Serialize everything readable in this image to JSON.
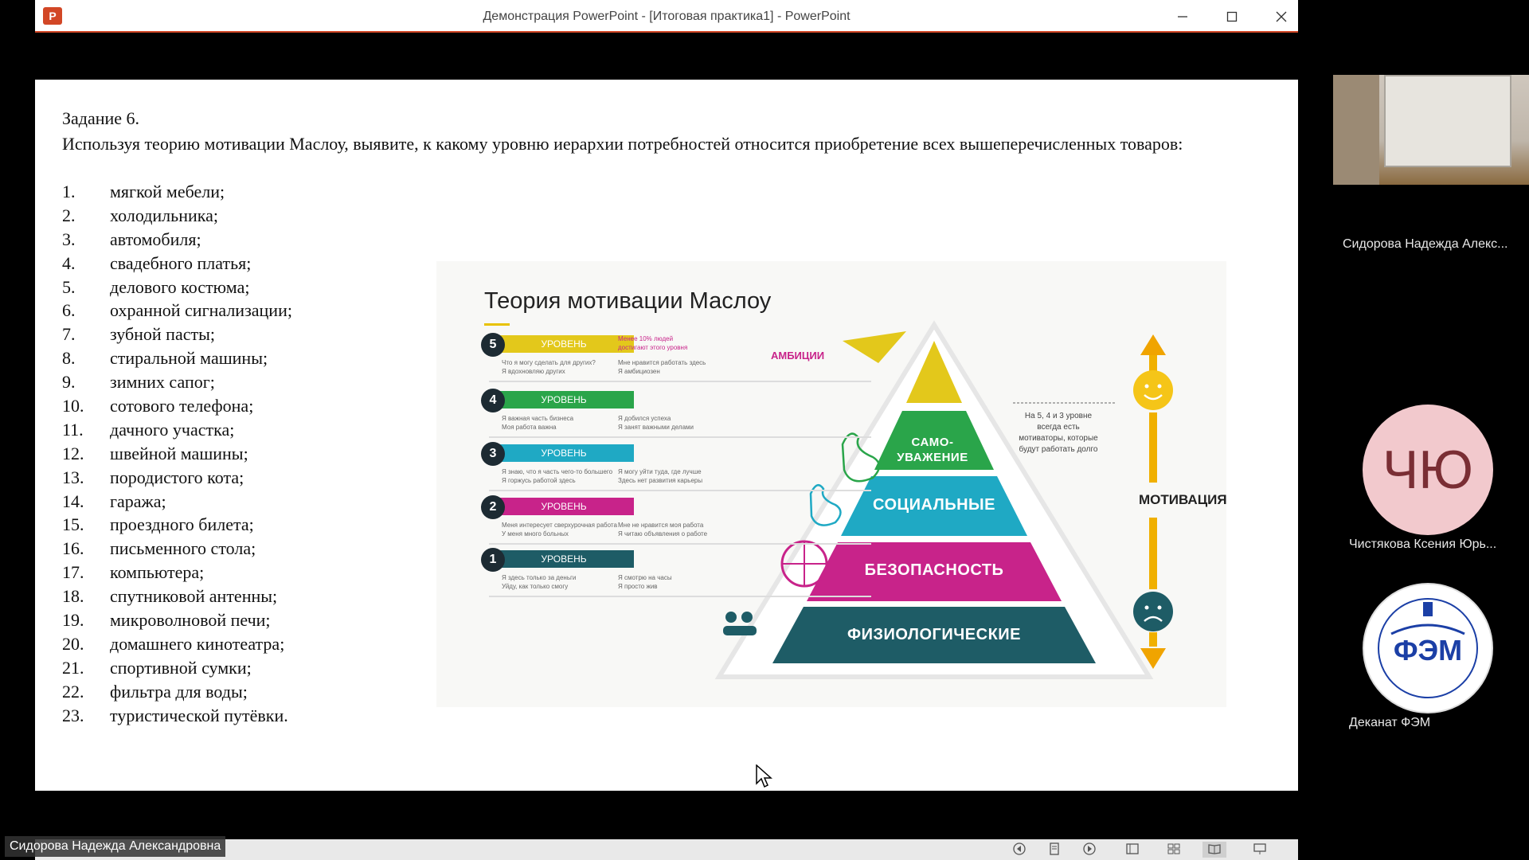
{
  "window": {
    "title": "Демонстрация PowerPoint - [Итоговая практика1] - PowerPoint",
    "app_icon": "P",
    "controls": {
      "minimize": "—",
      "maximize": "☐",
      "close": "✕"
    }
  },
  "slide": {
    "task_title": "Задание 6.",
    "task_text": "Используя теорию мотивации Маслоу, выявите, к какому уровню иерархии потребностей относится приобретение всех вышеперечисленных товаров:",
    "items": [
      {
        "num": "1.",
        "text": "мягкой мебели;"
      },
      {
        "num": "2.",
        "text": "холодильника;"
      },
      {
        "num": "3.",
        "text": "автомобиля;"
      },
      {
        "num": "4.",
        "text": "свадебного платья;"
      },
      {
        "num": "5.",
        "text": "делового костюма;"
      },
      {
        "num": "6.",
        "text": "охранной сигнализации;"
      },
      {
        "num": "7.",
        "text": "зубной пасты;"
      },
      {
        "num": "8.",
        "text": "стиральной машины;"
      },
      {
        "num": "9.",
        "text": "зимних сапог;"
      },
      {
        "num": "10.",
        "text": "сотового телефона;"
      },
      {
        "num": "11.",
        "text": "дачного участка;"
      },
      {
        "num": "12.",
        "text": "швейной машины;"
      },
      {
        "num": "13.",
        "text": "породистого кота;"
      },
      {
        "num": "14.",
        "text": "гаража;"
      },
      {
        "num": "15.",
        "text": "проездного билета;"
      },
      {
        "num": "16.",
        "text": "письменного стола;"
      },
      {
        "num": "17.",
        "text": "компьютера;"
      },
      {
        "num": "18.",
        "text": "спутниковой антенны;"
      },
      {
        "num": "19.",
        "text": "микроволновой печи;"
      },
      {
        "num": "20.",
        "text": "домашнего кинотеатра;"
      },
      {
        "num": "21.",
        "text": "спортивной сумки;"
      },
      {
        "num": "22.",
        "text": "фильтра для воды;"
      },
      {
        "num": "23.",
        "text": "туристической путёвки."
      }
    ],
    "infographic": {
      "title": "Теория мотивации Маслоу",
      "ambition_label": "АМБИЦИИ",
      "side_note": "На 5, 4 и 3 уровне всегда есть мотиваторы, которые будут работать долго",
      "motivation_label": "МОТИВАЦИЯ",
      "levels": [
        {
          "num": "5",
          "bar": "УРОВЕНЬ",
          "color": "#e3c81b",
          "pyramid": "",
          "note_a": "Что я могу сделать для других?\nЯ вдохновляю других",
          "note_b": "Мне нравится работать здесь\nЯ амбициозен",
          "top_note": "Менее 10% людей\nдостигают этого уровня"
        },
        {
          "num": "4",
          "bar": "УРОВЕНЬ",
          "color": "#2aa54a",
          "pyramid": "САМО-\nУВАЖЕНИЕ",
          "note_a": "Я важная часть бизнеса\nМоя работа важна",
          "note_b": "Я добился успеха\nЯ занят важными делами"
        },
        {
          "num": "3",
          "bar": "УРОВЕНЬ",
          "color": "#1fa9c4",
          "pyramid": "СОЦИАЛЬНЫЕ",
          "note_a": "Я знаю, что я часть чего-то большего\nЯ горжусь работой здесь",
          "note_b": "Я могу уйти туда, где лучше\nЗдесь нет развития карьеры"
        },
        {
          "num": "2",
          "bar": "УРОВЕНЬ",
          "color": "#c8238a",
          "pyramid": "БЕЗОПАСНОСТЬ",
          "note_a": "Меня интересует сверхурочная работа\nУ меня много больных",
          "note_b": "Мне не нравится моя работа\nЯ читаю объявления о работе"
        },
        {
          "num": "1",
          "bar": "УРОВЕНЬ",
          "color": "#1e5c66",
          "pyramid": "ФИЗИОЛОГИЧЕСКИЕ",
          "note_a": "Я здесь только за деньги\nУйду, как только смогу",
          "note_b": "Я смотрю на часы\nЯ просто жив"
        }
      ]
    }
  },
  "participants": [
    {
      "name": "Сидорова Надежда Алекс...",
      "type": "camera"
    },
    {
      "name": "Чистякова Ксения Юрь...",
      "initials": "ЧЮ",
      "type": "initials"
    },
    {
      "name": "Деканат ФЭМ",
      "logo_text": "ФЭМ",
      "logo_ring": "Факультет Экономики и Менеджмента",
      "type": "logo"
    }
  ],
  "speaker": "Сидорова Надежда Александровна",
  "icons": {
    "minimize": "minimize-icon",
    "maximize": "maximize-icon",
    "close": "close-icon",
    "prev": "previous-slide-icon",
    "next": "next-slide-icon",
    "notes": "notes-icon",
    "normal_view": "normal-view-icon",
    "sorter_view": "slide-sorter-icon",
    "reading_view": "reading-view-icon",
    "slideshow": "slideshow-icon"
  }
}
